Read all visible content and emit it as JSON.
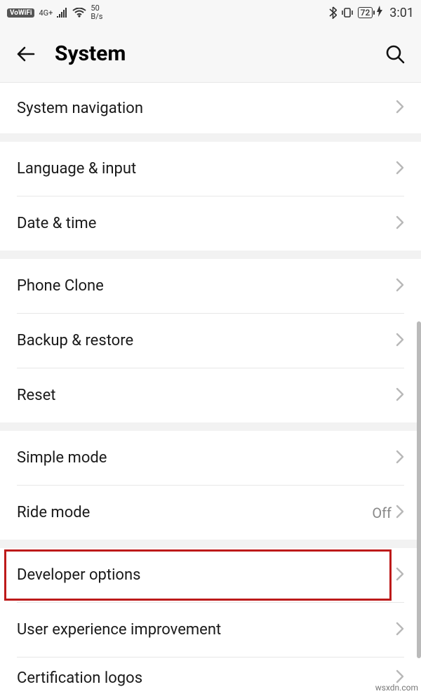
{
  "status": {
    "vowifi": "VoWiFi",
    "net_gen": "4G+",
    "data_rate_num": "50",
    "data_rate_unit": "B/s",
    "battery": "72",
    "time": "3:01"
  },
  "header": {
    "title": "System"
  },
  "groups": [
    {
      "rows": [
        {
          "label": "System navigation",
          "value": null
        }
      ]
    },
    {
      "rows": [
        {
          "label": "Language & input",
          "value": null
        },
        {
          "label": "Date & time",
          "value": null
        }
      ]
    },
    {
      "rows": [
        {
          "label": "Phone Clone",
          "value": null
        },
        {
          "label": "Backup & restore",
          "value": null
        },
        {
          "label": "Reset",
          "value": null
        }
      ]
    },
    {
      "rows": [
        {
          "label": "Simple mode",
          "value": null
        },
        {
          "label": "Ride mode",
          "value": "Off"
        }
      ]
    },
    {
      "rows": [
        {
          "label": "Developer options",
          "value": null
        },
        {
          "label": "User experience improvement",
          "value": null
        },
        {
          "label": "Certification logos",
          "value": null
        }
      ]
    }
  ],
  "watermark": "wsxdn.com",
  "highlighted_row_label": "Developer options"
}
